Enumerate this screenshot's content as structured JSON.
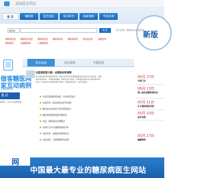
{
  "header": {
    "site_title": "...尿病医生网站"
  },
  "nav": {
    "home": "首 页",
    "tabs": [
      "糖尿病",
      "医生团队",
      "医学研究",
      "临床指南",
      "专家咨询"
    ]
  },
  "search": {
    "select_value": "糖尿病",
    "button": "搜 索",
    "hot_label": "热门搜索：糖尿病 饮食 胰岛素"
  },
  "links": {
    "row": [
      "糖尿病诊断",
      "糖尿病并发症",
      "糖尿病饮食",
      "糖尿病运动",
      "糖尿病用药",
      "胰岛素治疗",
      "血糖监测",
      "糖尿病足",
      "妊娠糖尿病",
      "儿童糖尿病"
    ]
  },
  "badge": {
    "text": "新版"
  },
  "left_banner": {
    "line1": "做客糖医网",
    "line2": "家互动病例",
    "line3": "互动病例讨论",
    "tag_text": "8.0",
    "sub_text": "每周六 18.00 视频讲座"
  },
  "main": {
    "tabs": [
      "医学动态",
      "医学视频",
      "专题视角"
    ],
    "active_tab": 0,
    "article_title": "北医课堂第六期：合理运动有保障",
    "article_lines": [
      "第六期北医课堂将邀请北医三院内分泌科专家讲解糖尿病患者运动注意事项，帮助",
      "病友科学运动、合理控制血糖，降低并发症风险，同时解答病友关心的各类问题。",
      "欢迎广大病友及家属踊跃报名参加，现场名额有限，请尽早报名。"
    ],
    "list": [
      "北医北医糖尿病讲座：饮食误区盘点",
      "北医研究：胰岛素泵治疗新进展",
      "糖友的饮食指导与营养搭配建议",
      "糖尿病视网膜病变早期筛查",
      "北医：糖尿病足护理要点",
      "运动疗法对2型糖尿病的影响",
      "北医专家：血糖监测频率建议",
      "北医讲座：口服降糖药的选择"
    ]
  },
  "right": {
    "items": [
      {
        "date": "05月 27日",
        "text": "专家门诊"
      },
      {
        "date": "06月 13日",
        "text": "第八届北医糖尿病论坛"
      },
      {
        "date": "05月 11日",
        "text": "北大糖尿病研究室"
      },
      {
        "date": "05月 10日",
        "text": "医学讲座"
      },
      {
        "date": "05月 17日",
        "text": "健康教育"
      }
    ]
  },
  "footer": {
    "logo_text": "网",
    "slogan": "中国最大最专业的糖尿病医生网站"
  },
  "colors": {
    "nav_blue": "#1e6fc0",
    "accent_red": "#c0392b",
    "footer_blue": "#1a5fab"
  }
}
